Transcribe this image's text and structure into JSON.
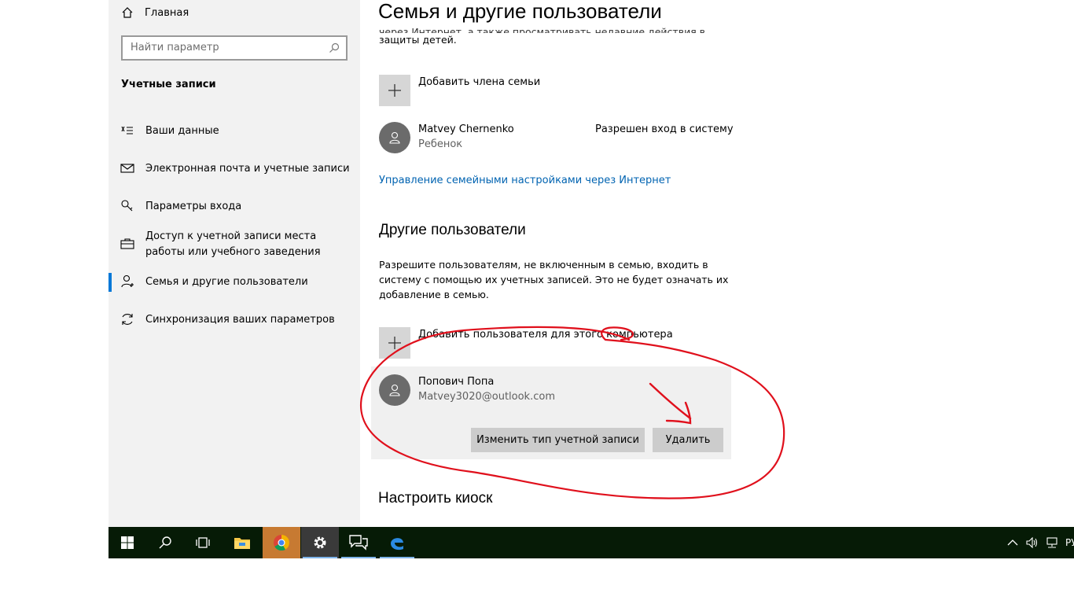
{
  "nav": {
    "home_label": "Главная",
    "search_placeholder": "Найти параметр",
    "section_title": "Учетные записи",
    "items": [
      {
        "label": "Ваши данные",
        "icon": "person-details-icon"
      },
      {
        "label": "Электронная почта и учетные записи",
        "icon": "mail-icon"
      },
      {
        "label": "Параметры входа",
        "icon": "key-icon"
      },
      {
        "label": "Доступ к учетной записи места работы или учебного заведения",
        "icon": "briefcase-icon"
      },
      {
        "label": "Семья и другие пользователи",
        "icon": "person-icon",
        "selected": true
      },
      {
        "label": "Синхронизация ваших параметров",
        "icon": "sync-icon"
      }
    ]
  },
  "main": {
    "title": "Семья и другие пользователи",
    "intro_cut": "через Интернет, а также просматривать недавние действия в целях",
    "intro_line": "защиты детей.",
    "add_family_label": "Добавить члена семьи",
    "family_member": {
      "name": "Matvey Chernenko",
      "role": "Ребенок",
      "status": "Разрешен вход в систему"
    },
    "manage_link": "Управление семейными настройками через Интернет",
    "other_users_heading": "Другие пользователи",
    "other_users_text": "Разрешите пользователям, не включенным в семью, входить в систему с помощью их учетных записей. Это не будет означать их добавление в семью.",
    "add_user_label": "Добавить пользователя для этого компьютера",
    "other_user": {
      "name": "Попович Попа",
      "email": "Matvey3020@outlook.com"
    },
    "change_type_button": "Изменить тип учетной записи",
    "delete_button": "Удалить",
    "kiosk_heading": "Настроить киоск"
  },
  "taskbar": {
    "items": [
      "start-icon",
      "search-icon",
      "task-view-icon",
      "file-explorer-icon",
      "chrome-icon",
      "settings-icon",
      "feedback-icon",
      "edge-icon"
    ],
    "language": "РУ"
  },
  "colors": {
    "accent": "#0078d7",
    "link": "#0063b1",
    "annotation": "#e0101c",
    "taskbar": "#061b06"
  }
}
